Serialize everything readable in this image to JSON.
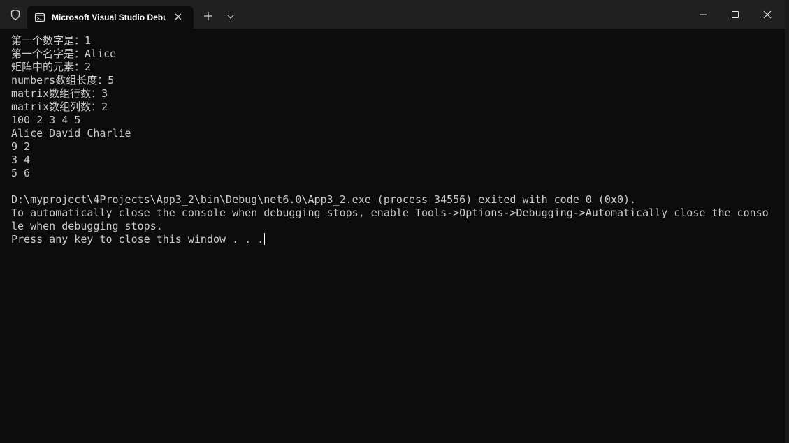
{
  "window": {
    "tab_title": "Microsoft Visual Studio Debug Console",
    "icons": {
      "shield": "shield-icon",
      "terminal": "terminal-icon",
      "close_tab": "close-icon",
      "new_tab": "plus-icon",
      "dropdown": "chevron-down-icon",
      "minimize": "minimize-icon",
      "maximize": "maximize-icon",
      "close_window": "close-icon"
    },
    "colors": {
      "titlebar": "#202020",
      "console_bg": "#0c0c0c",
      "console_text": "#cccccc"
    }
  },
  "console": {
    "lines": [
      "第一个数字是：1",
      "第一个名字是：Alice",
      "矩阵中的元素：2",
      "numbers数组长度：5",
      "matrix数组行数：3",
      "matrix数组列数：2",
      "100 2 3 4 5",
      "Alice David Charlie",
      "9 2",
      "3 4",
      "5 6",
      "",
      "D:\\myproject\\4Projects\\App3_2\\bin\\Debug\\net6.0\\App3_2.exe (process 34556) exited with code 0 (0x0).",
      "To automatically close the console when debugging stops, enable Tools->Options->Debugging->Automatically close the conso",
      "le when debugging stops.",
      "Press any key to close this window . . ."
    ]
  }
}
